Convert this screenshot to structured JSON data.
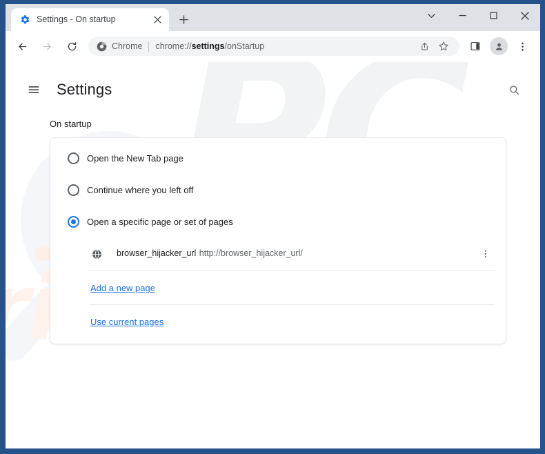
{
  "window": {
    "controls": {
      "chevron_down": "chevron-down",
      "minimize": "minimize",
      "maximize": "maximize",
      "close": "close"
    }
  },
  "tab_strip": {
    "active_tab": {
      "title": "Settings - On startup",
      "favicon": "gear-icon",
      "close_label": "×"
    },
    "new_tab_label": "+"
  },
  "toolbar": {
    "back_label": "←",
    "forward_label": "→",
    "reload_label": "↻",
    "omnibox": {
      "security_label": "Chrome",
      "url_prefix": "chrome://",
      "url_bold": "settings",
      "url_suffix": "/onStartup",
      "full_url": "chrome://settings/onStartup"
    },
    "share_icon": "share-icon",
    "bookmark_icon": "star-icon",
    "side_panel_icon": "side-panel-icon",
    "profile_icon": "profile-avatar-icon",
    "menu_icon": "three-dot-menu-icon"
  },
  "settings": {
    "menu_icon": "hamburger-icon",
    "title": "Settings",
    "search_icon": "search-icon",
    "section_heading": "On startup",
    "startup_options": [
      {
        "label": "Open the New Tab page",
        "selected": false
      },
      {
        "label": "Continue where you left off",
        "selected": false
      },
      {
        "label": "Open a specific page or set of pages",
        "selected": true
      }
    ],
    "startup_pages": [
      {
        "favicon": "globe-icon",
        "title": "browser_hijacker_url",
        "url": "http://browser_hijacker_url/",
        "menu_icon": "three-dot-menu-icon"
      }
    ],
    "links": {
      "add_new_page": "Add a new page",
      "use_current_pages": "Use current pages"
    }
  },
  "watermarks": {
    "logo_text": "PC",
    "site_text": "risk.com"
  },
  "colors": {
    "frame_blue": "#25528a",
    "accent_blue": "#1a73e8",
    "tab_strip": "#dee1e6",
    "omnibox_bg": "#f1f3f4",
    "text_primary": "#202124",
    "text_secondary": "#5f6368"
  }
}
